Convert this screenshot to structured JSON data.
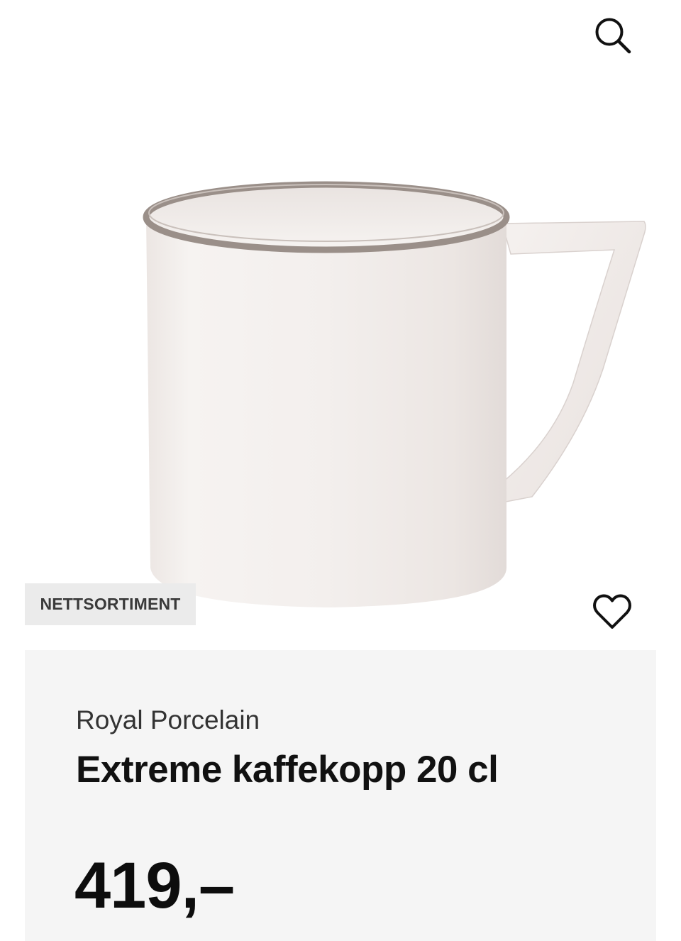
{
  "header": {
    "search_icon": "search-icon"
  },
  "product": {
    "badge": "NETTSORTIMENT",
    "favorite_icon": "heart-outline-icon",
    "brand": "Royal Porcelain",
    "name": "Extreme kaffekopp 20 cl",
    "price": "419,–",
    "image": "white-porcelain-mug-with-platinum-rim"
  },
  "colors": {
    "panel_background": "#f5f5f5",
    "badge_background": "#ebebeb",
    "text_primary": "#111111",
    "rim": "#9a8f89"
  }
}
